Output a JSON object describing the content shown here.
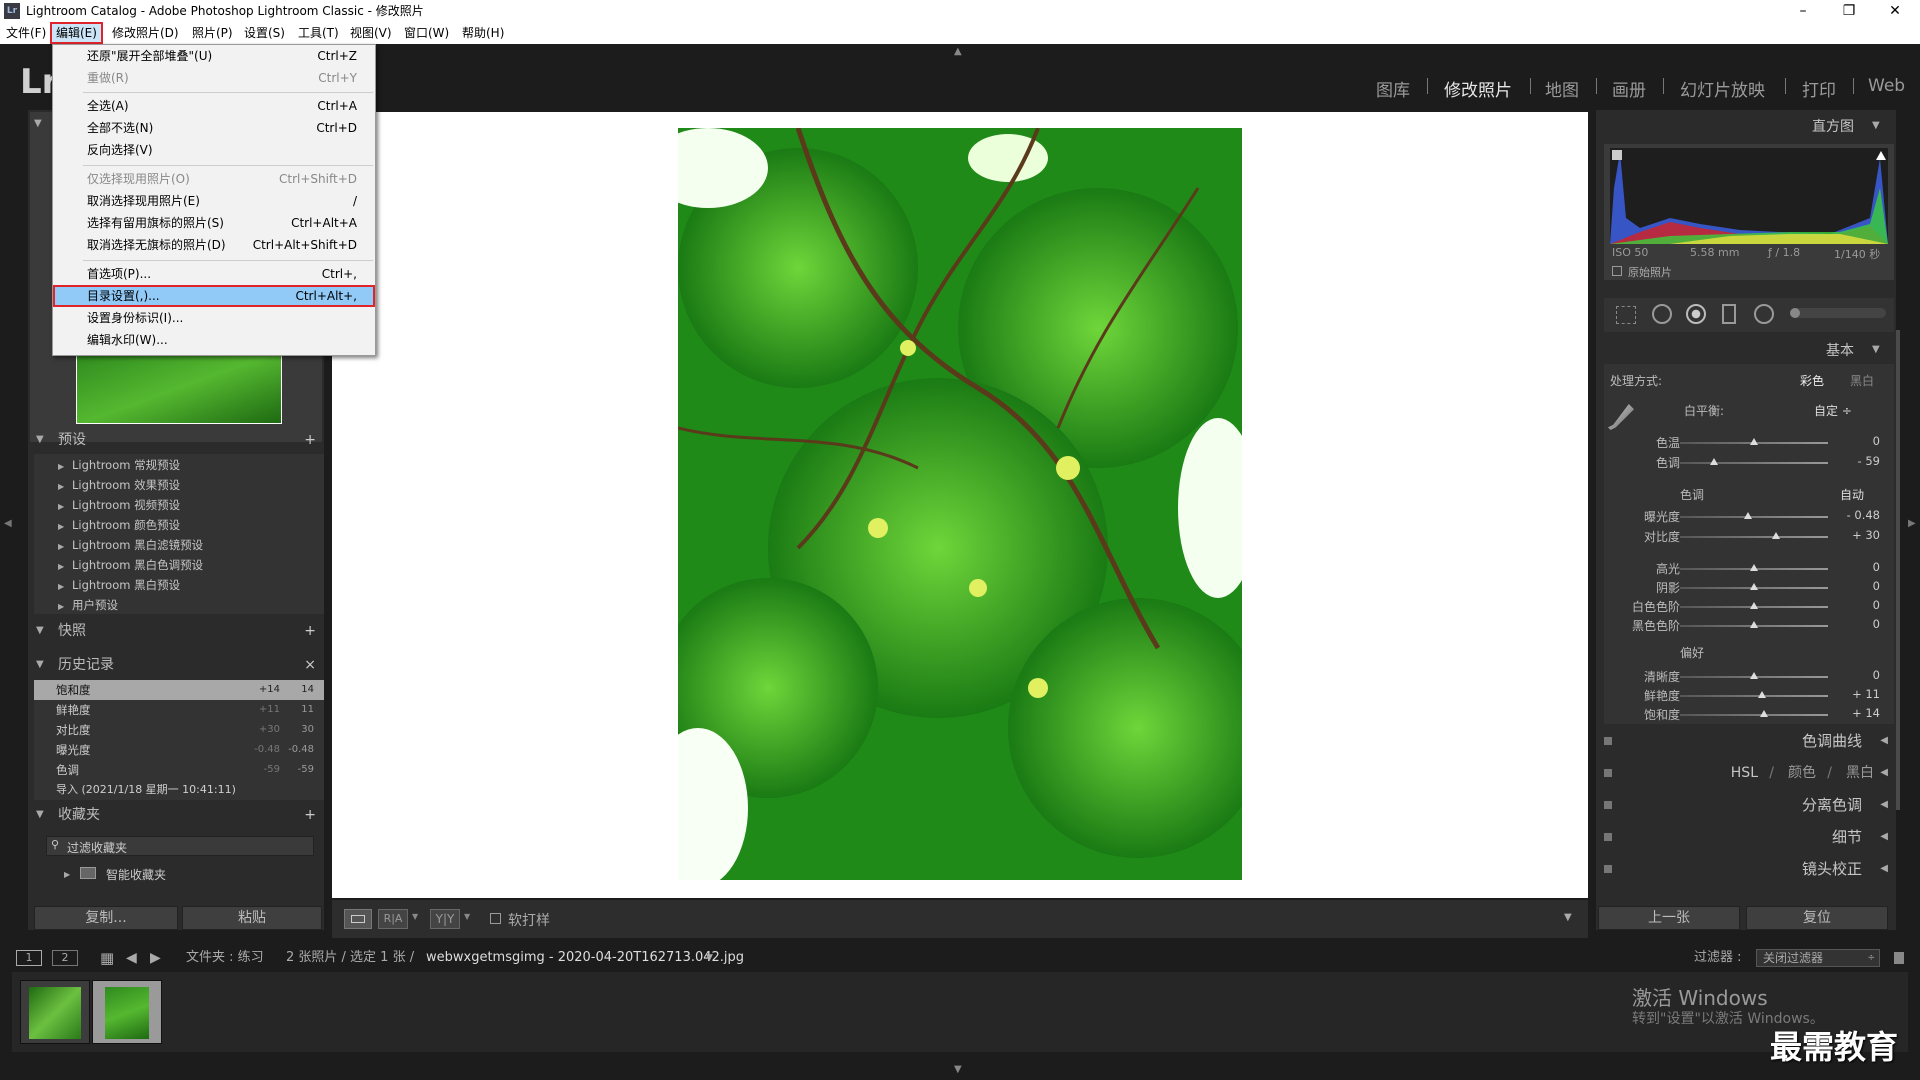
{
  "window": {
    "title": "Lightroom Catalog - Adobe Photoshop Lightroom Classic - 修改照片",
    "app_badge": "Lr"
  },
  "menubar": [
    "文件(F)",
    "编辑(E)",
    "修改照片(D)",
    "照片(P)",
    "设置(S)",
    "工具(T)",
    "视图(V)",
    "窗口(W)",
    "帮助(H)"
  ],
  "edit_menu": [
    {
      "label": "还原\"展开全部堆叠\"(U)",
      "shortcut": "Ctrl+Z",
      "disabled": false
    },
    {
      "label": "重做(R)",
      "shortcut": "Ctrl+Y",
      "disabled": true
    },
    {
      "label": "全选(A)",
      "shortcut": "Ctrl+A",
      "disabled": false
    },
    {
      "label": "全部不选(N)",
      "shortcut": "Ctrl+D",
      "disabled": false
    },
    {
      "label": "反向选择(V)",
      "shortcut": "",
      "disabled": false
    },
    {
      "label": "仅选择现用照片(O)",
      "shortcut": "Ctrl+Shift+D",
      "disabled": true
    },
    {
      "label": "取消选择现用照片(E)",
      "shortcut": "/",
      "disabled": false
    },
    {
      "label": "选择有留用旗标的照片(S)",
      "shortcut": "Ctrl+Alt+A",
      "disabled": false
    },
    {
      "label": "取消选择无旗标的照片(D)",
      "shortcut": "Ctrl+Alt+Shift+D",
      "disabled": false
    },
    {
      "label": "首选项(P)...",
      "shortcut": "Ctrl+,",
      "disabled": false
    },
    {
      "label": "目录设置(,)...",
      "shortcut": "Ctrl+Alt+,",
      "disabled": false
    },
    {
      "label": "设置身份标识(I)...",
      "shortcut": "",
      "disabled": false
    },
    {
      "label": "编辑水印(W)...",
      "shortcut": "",
      "disabled": false
    }
  ],
  "modules": [
    "图库",
    "修改照片",
    "地图",
    "画册",
    "幻灯片放映",
    "打印",
    "Web"
  ],
  "left": {
    "presets_title": "预设",
    "presets": [
      "Lightroom 常规预设",
      "Lightroom 效果预设",
      "Lightroom 视频预设",
      "Lightroom 颜色预设",
      "Lightroom 黑白滤镜预设",
      "Lightroom 黑白色调预设",
      "Lightroom 黑白预设",
      "用户预设"
    ],
    "snapshots_title": "快照",
    "history_title": "历史记录",
    "history": [
      {
        "name": "饱和度",
        "a": "+14",
        "b": "14"
      },
      {
        "name": "鲜艳度",
        "a": "+11",
        "b": "11"
      },
      {
        "name": "对比度",
        "a": "+30",
        "b": "30"
      },
      {
        "name": "曝光度",
        "a": "-0.48",
        "b": "-0.48"
      },
      {
        "name": "色调",
        "a": "-59",
        "b": "-59"
      },
      {
        "name": "导入 (2021/1/18 星期一 10:41:11)",
        "a": "",
        "b": ""
      }
    ],
    "collections_title": "收藏夹",
    "filter_collections": "过滤收藏夹",
    "smart_collections": "智能收藏夹",
    "copy_btn": "复制...",
    "paste_btn": "粘贴"
  },
  "toolbar": {
    "soft_proof": "软打样"
  },
  "right": {
    "histogram_title": "直方图",
    "iso": "ISO 50",
    "focal": "5.58 mm",
    "aperture": "ƒ / 1.8",
    "shutter": "1/140 秒",
    "original_photo": "原始照片",
    "basic_title": "基本",
    "treatment_label": "处理方式:",
    "treatment_color": "彩色",
    "treatment_bw": "黑白",
    "wb_label": "白平衡:",
    "wb_value": "自定 ÷",
    "tone_label": "色调",
    "auto_label": "自动",
    "presence_label": "偏好",
    "sliders": [
      {
        "name": "色温",
        "value": "0",
        "pos": 0.5
      },
      {
        "name": "色调",
        "value": "- 59",
        "pos": 0.23
      },
      {
        "name": "曝光度",
        "value": "- 0.48",
        "pos": 0.46
      },
      {
        "name": "对比度",
        "value": "+ 30",
        "pos": 0.65
      },
      {
        "name": "高光",
        "value": "0",
        "pos": 0.5
      },
      {
        "name": "阴影",
        "value": "0",
        "pos": 0.5
      },
      {
        "name": "白色色阶",
        "value": "0",
        "pos": 0.5
      },
      {
        "name": "黑色色阶",
        "value": "0",
        "pos": 0.5
      },
      {
        "name": "清晰度",
        "value": "0",
        "pos": 0.5
      },
      {
        "name": "鲜艳度",
        "value": "+ 11",
        "pos": 0.555
      },
      {
        "name": "饱和度",
        "value": "+ 14",
        "pos": 0.57
      }
    ],
    "sections": [
      "色调曲线",
      "HSL",
      "颜色",
      "黑白",
      "分离色调",
      "细节",
      "镜头校正"
    ],
    "prev_btn": "上一张",
    "reset_btn": "复位"
  },
  "status": {
    "pages": [
      "1",
      "2"
    ],
    "folder": "文件夹 : 练习",
    "count": "2 张照片 / 选定 1 张 /",
    "filename": "webwxgetmsgimg - 2020-04-20T162713.042.jpg",
    "filter_label": "过滤器 :",
    "filter_value": "关闭过滤器"
  },
  "watermark": {
    "line1": "激活 Windows",
    "line2": "转到\"设置\"以激活 Windows。",
    "brand": "最需教育"
  }
}
